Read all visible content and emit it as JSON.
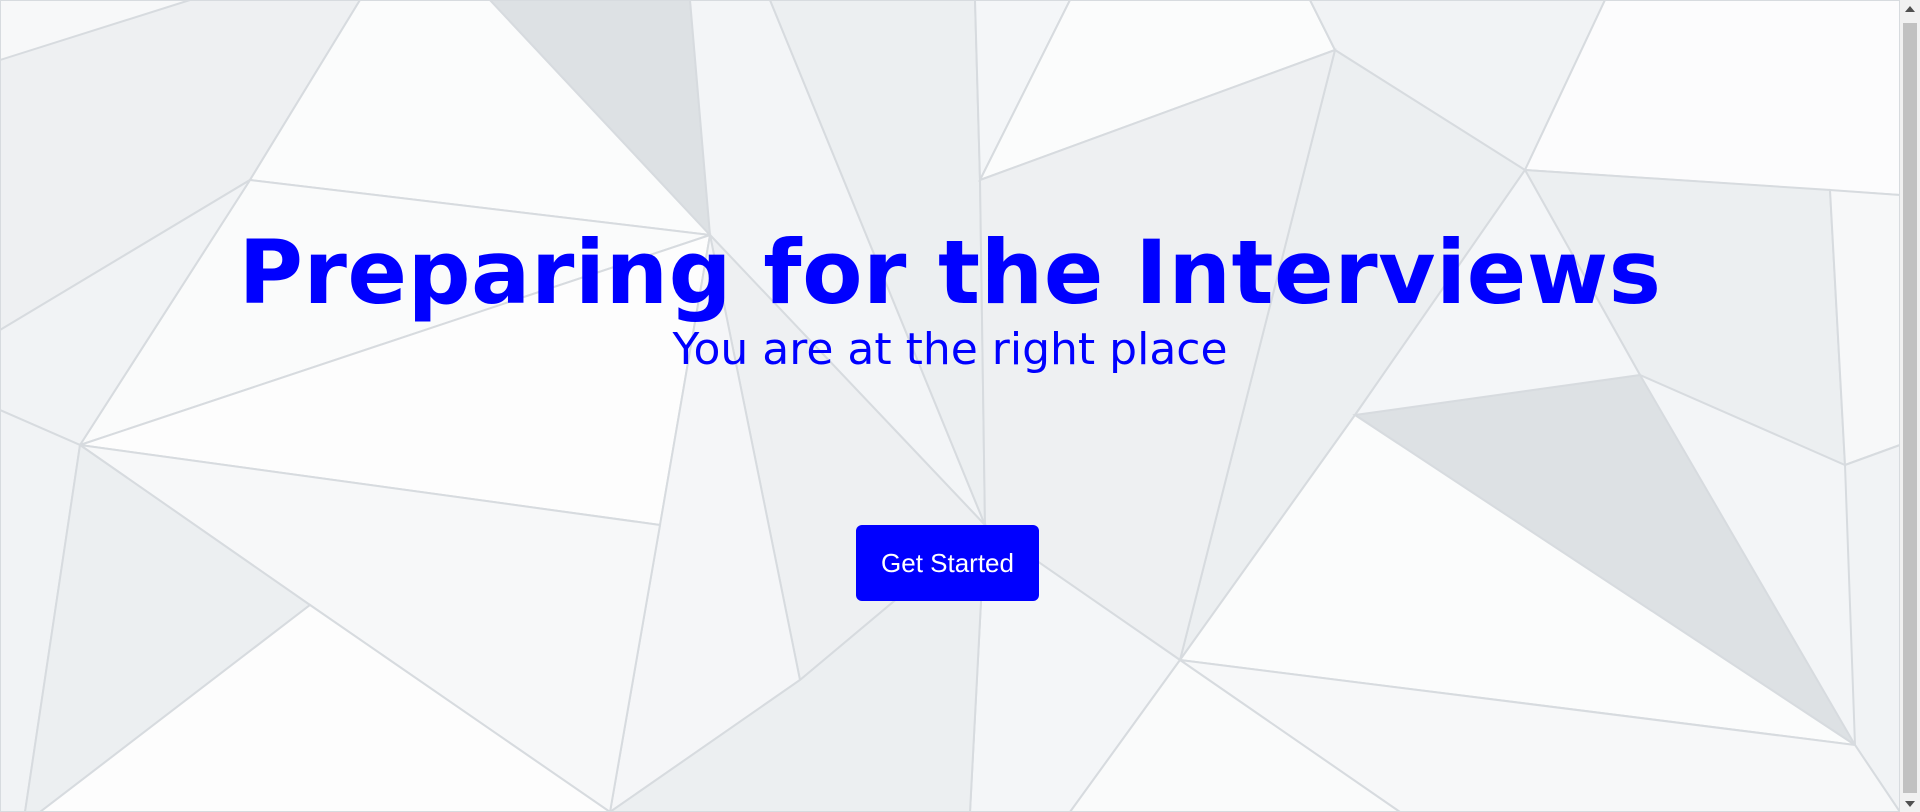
{
  "hero": {
    "title": "Preparing for the Interviews",
    "subtitle": "You are at the right place",
    "cta_label": "Get Started"
  },
  "colors": {
    "accent": "#0000ff",
    "button_text": "#ffffff",
    "background": "#f3f5f7",
    "line": "#d7dbdf"
  },
  "icons": {
    "scroll_up": "triangle-up",
    "scroll_down": "triangle-down"
  }
}
